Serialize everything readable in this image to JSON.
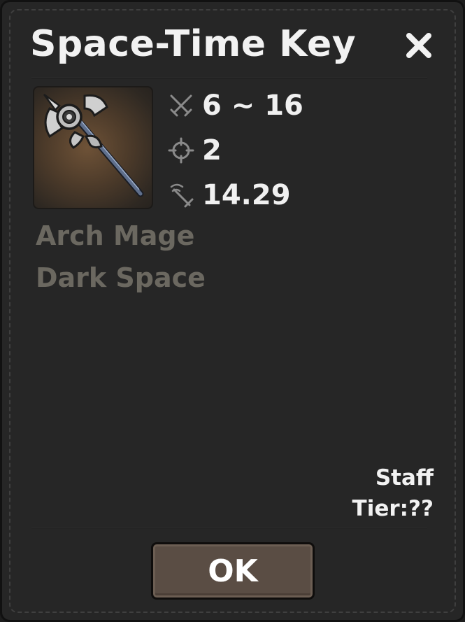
{
  "dialog": {
    "title": "Space-Time Key",
    "close_icon": "close-icon"
  },
  "item": {
    "image_icon": "staff-icon",
    "stats": {
      "damage": {
        "icon": "crossed-swords-icon",
        "value": "6 ~ 16"
      },
      "range": {
        "icon": "crosshair-icon",
        "value": "2"
      },
      "attack_speed": {
        "icon": "sword-speed-icon",
        "value": "14.29"
      }
    },
    "tags": [
      "Arch Mage",
      "Dark Space"
    ],
    "type": "Staff",
    "tier": "Tier:??"
  },
  "footer": {
    "ok_label": "OK"
  },
  "colors": {
    "panel_bg": "#262626",
    "tag_text": "#6b6860",
    "button_bg": "#5a4d44"
  }
}
